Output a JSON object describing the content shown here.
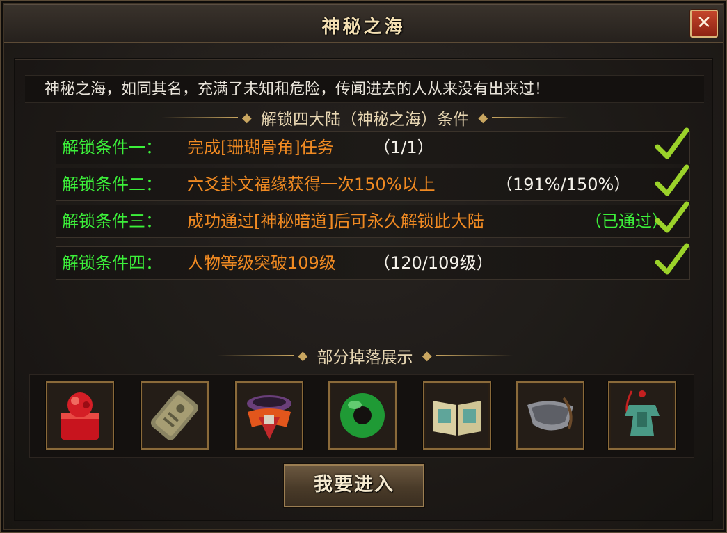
{
  "window": {
    "title": "神秘之海",
    "close_icon": "close-icon"
  },
  "description": "神秘之海，如同其名，充满了未知和危险，传闻进去的人从来没有出来过！",
  "conditions_header": "解锁四大陆（神秘之海）条件",
  "conditions": [
    {
      "label": "解锁条件一：",
      "desc": "完成[珊瑚骨角]任务",
      "progress": "（1/1）",
      "completed": true
    },
    {
      "label": "解锁条件二：",
      "desc": "六爻卦文福缘获得一次150%以上",
      "progress": "（191%/150%）",
      "completed": true
    },
    {
      "label": "解锁条件三：",
      "desc": "成功通过[神秘暗道]后可永久解锁此大陆",
      "progress": "（已通过）",
      "completed": true
    },
    {
      "label": "解锁条件四：",
      "desc": "人物等级突破109级",
      "progress": "（120/109级）",
      "completed": true
    }
  ],
  "drops_header": "部分掉落展示",
  "drops": [
    {
      "icon": "red-seal-icon"
    },
    {
      "icon": "stone-tablet-icon"
    },
    {
      "icon": "belt-armor-icon"
    },
    {
      "icon": "jade-ring-icon"
    },
    {
      "icon": "book-icon"
    },
    {
      "icon": "bracer-icon"
    },
    {
      "icon": "jade-pendant-icon"
    }
  ],
  "enter_button": "我要进入",
  "colors": {
    "condition_label": "#3cf03a",
    "condition_desc": "#f08a22",
    "progress": "#f5f2ea",
    "check": "#9bd22a"
  }
}
